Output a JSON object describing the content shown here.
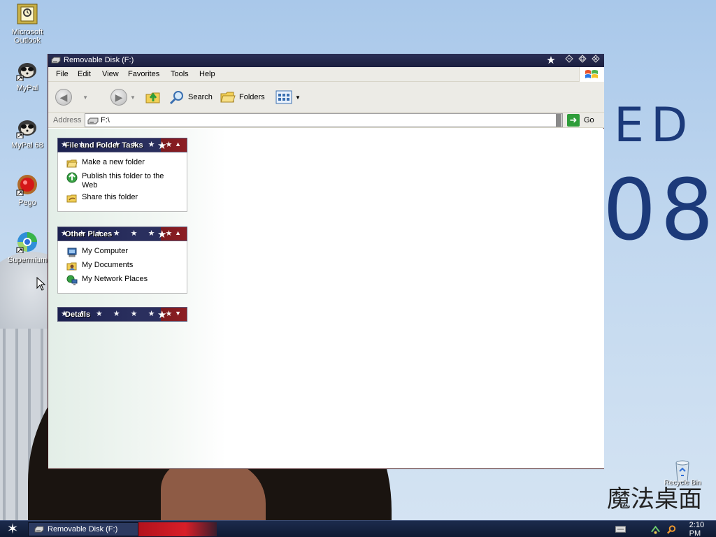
{
  "desktop": {
    "icons": [
      {
        "label": "Microsoft Outlook"
      },
      {
        "label": "MyPal"
      },
      {
        "label": "MyPal 68"
      },
      {
        "label": "Pego"
      },
      {
        "label": "Supermium"
      }
    ],
    "wallpaper_text": {
      "top": "ED",
      "bottom": "08",
      "logo": "魔法桌面",
      "recycle": "Recycle Bin"
    }
  },
  "window": {
    "title": "Removable Disk (F:)",
    "menu": [
      "File",
      "Edit",
      "View",
      "Favorites",
      "Tools",
      "Help"
    ],
    "toolbar": {
      "search": "Search",
      "folders": "Folders"
    },
    "address": {
      "label": "Address",
      "value": "F:\\",
      "go": "Go"
    },
    "panels": {
      "file_folder": {
        "title": "File and Folder Tasks",
        "items": [
          "Make a new folder",
          "Publish this folder to the Web",
          "Share this folder"
        ]
      },
      "other_places": {
        "title": "Other Places",
        "items": [
          "My Computer",
          "My Documents",
          "My Network Places"
        ]
      },
      "details": {
        "title": "Details"
      }
    }
  },
  "taskbar": {
    "task": "Removable Disk (F:)",
    "clock": "2:10 PM"
  },
  "colors": {
    "titlebar": "#1b1f3f",
    "panel_blue": "#1c2150",
    "panel_red": "#8e1e24",
    "go_green": "#2f9d3a"
  }
}
